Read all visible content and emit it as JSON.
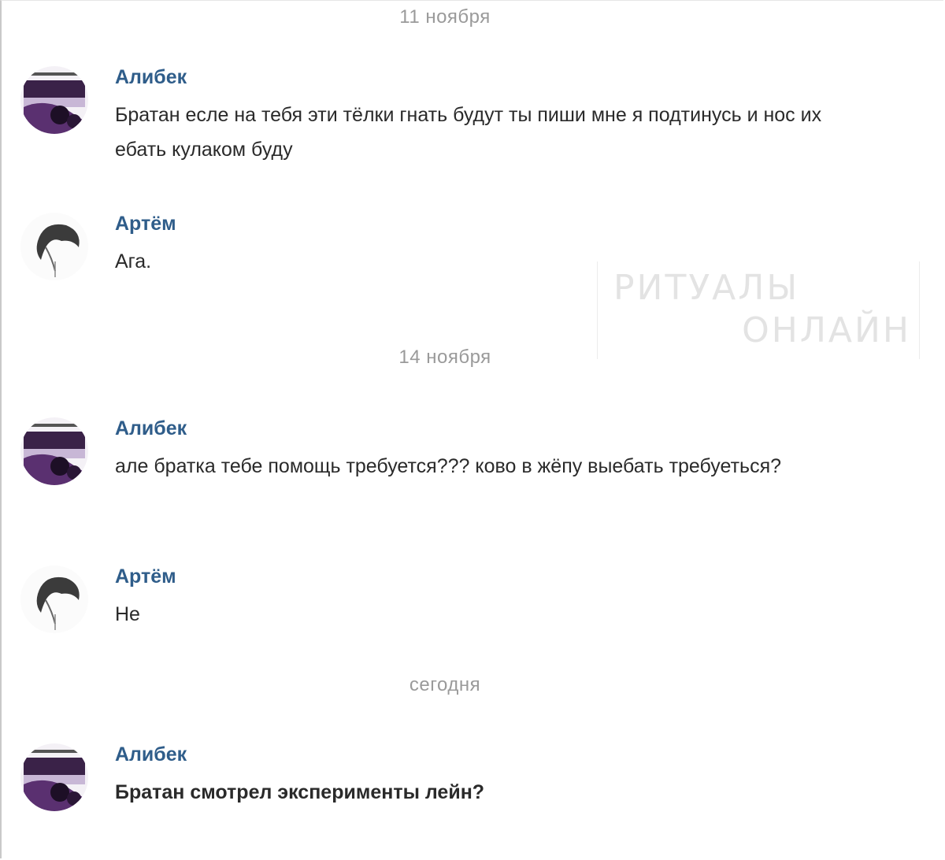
{
  "watermark": {
    "line1": "РИТУАЛЫ",
    "line2": "ОНЛАЙН"
  },
  "dates": [
    "11 ноября",
    "14 ноября",
    "сегодня"
  ],
  "messages": [
    {
      "author": "Алибек",
      "avatar_icon": "alibek-avatar-icon",
      "text": "Братан есле на тебя эти тёлки гнать будут ты пиши мне я подтинусь и нос их ебать кулаком буду"
    },
    {
      "author": "Артём",
      "avatar_icon": "artem-avatar-icon",
      "text": "Ага."
    },
    {
      "author": "Алибек",
      "avatar_icon": "alibek-avatar-icon",
      "text": "але братка тебе помощь требуется??? ково в жёпу выебать требуеться?"
    },
    {
      "author": "Артём",
      "avatar_icon": "artem-avatar-icon",
      "text": "Не"
    },
    {
      "author": "Алибек",
      "avatar_icon": "alibek-avatar-icon",
      "text": "Братан смотрел эксперименты лейн?"
    }
  ],
  "colors": {
    "author": "#2f5d8a",
    "date": "#9a9a9a",
    "text": "#2a2a2a",
    "avatar_accent": "#4a2a5e"
  }
}
